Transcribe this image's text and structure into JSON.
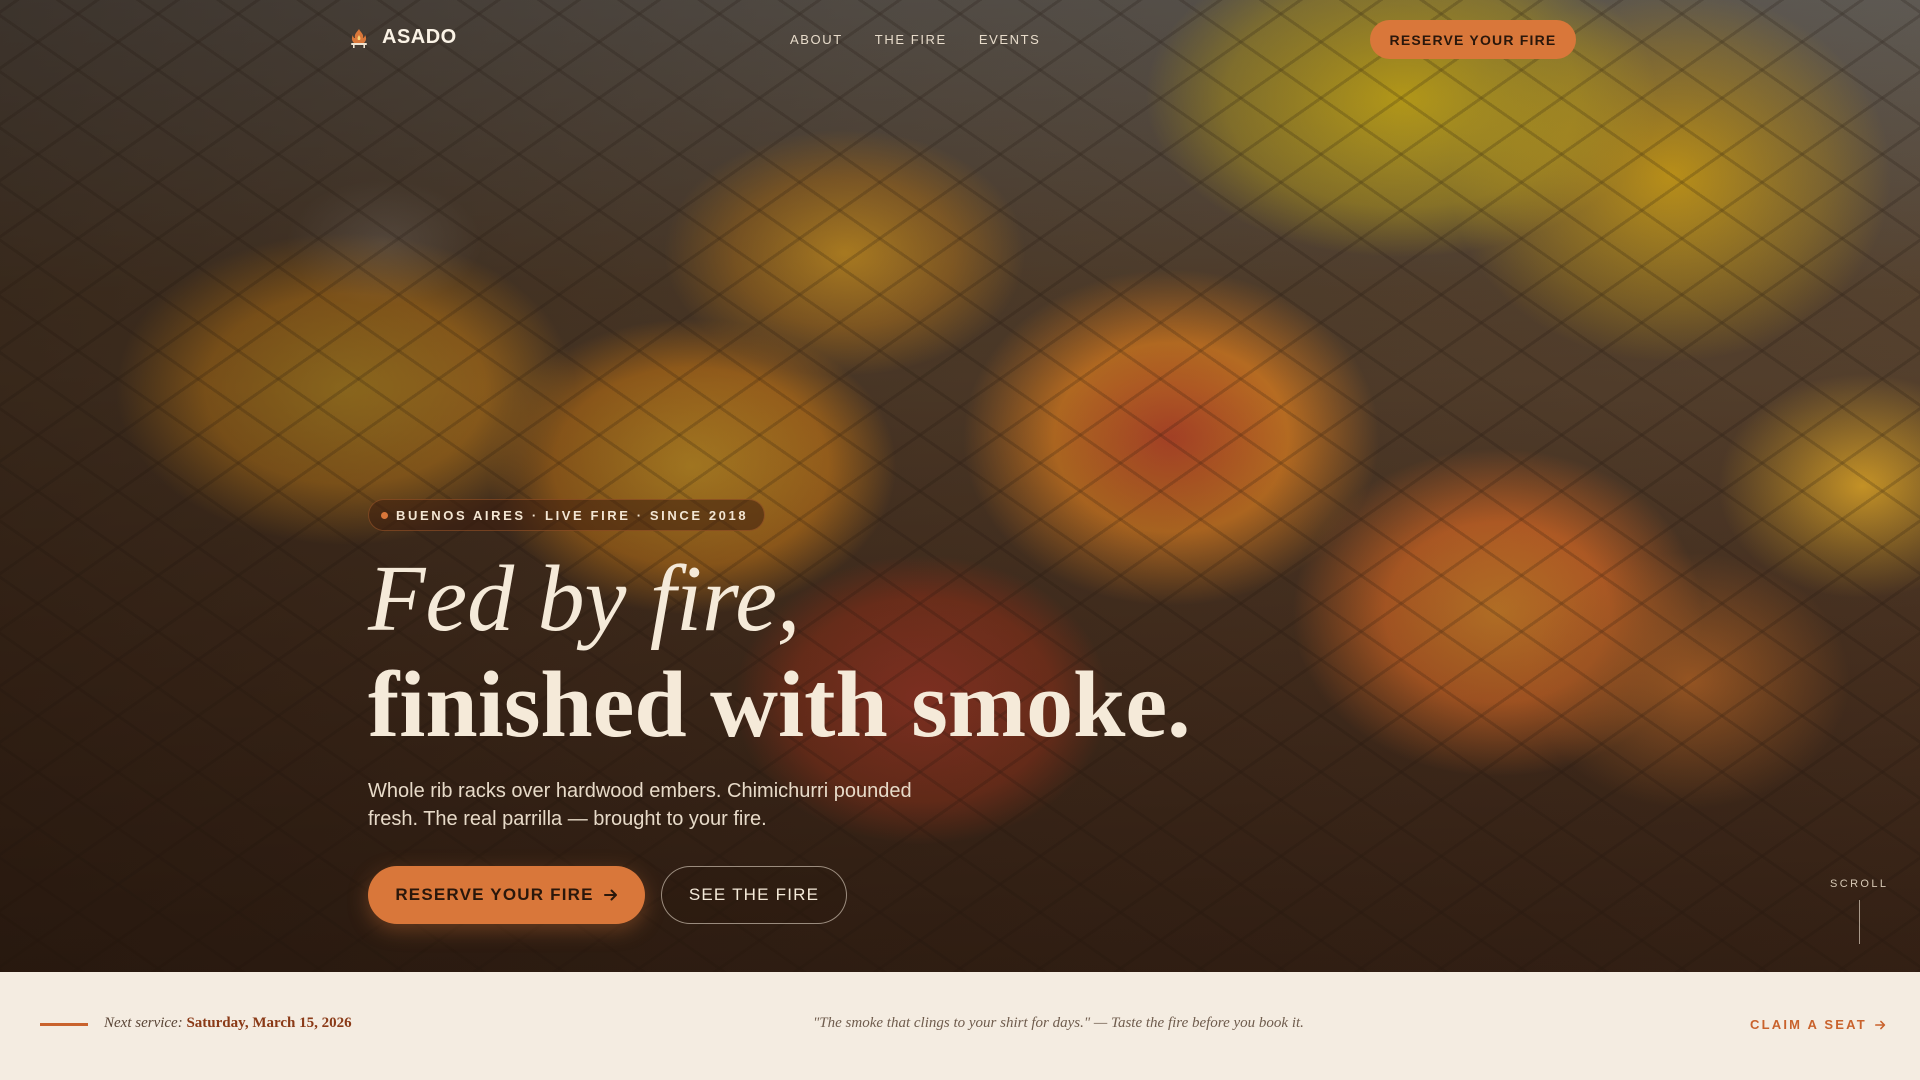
{
  "brand": {
    "name": "ASADO",
    "icon": "fire-grill-icon"
  },
  "nav": {
    "links": [
      "ABOUT",
      "THE FIRE",
      "EVENTS"
    ],
    "cta_label": "RESERVE YOUR FIRE"
  },
  "hero": {
    "eyebrow": "BUENOS AIRES · LIVE FIRE · SINCE 2018",
    "headline_line1": "Fed by fire,",
    "headline_line2": "finished with smoke.",
    "subtext": "Whole rib racks over hardwood embers. Chimichurri pounded fresh. The real parrilla — brought to your fire.",
    "primary_button": "RESERVE YOUR FIRE",
    "secondary_button": "SEE THE FIRE",
    "scroll_label": "SCROLL"
  },
  "strip": {
    "next_service_label": "Next service:",
    "next_service_date": "Saturday, March 15, 2026",
    "quote": "\"The smoke that clings to your shirt for days.\" — Taste the fire before you book it.",
    "claim_label": "CLAIM A SEAT"
  },
  "colors": {
    "accent": "#d9773a",
    "accent_dark": "#c9622c",
    "cream": "#f4ece1",
    "date_brown": "#8a3a17"
  }
}
